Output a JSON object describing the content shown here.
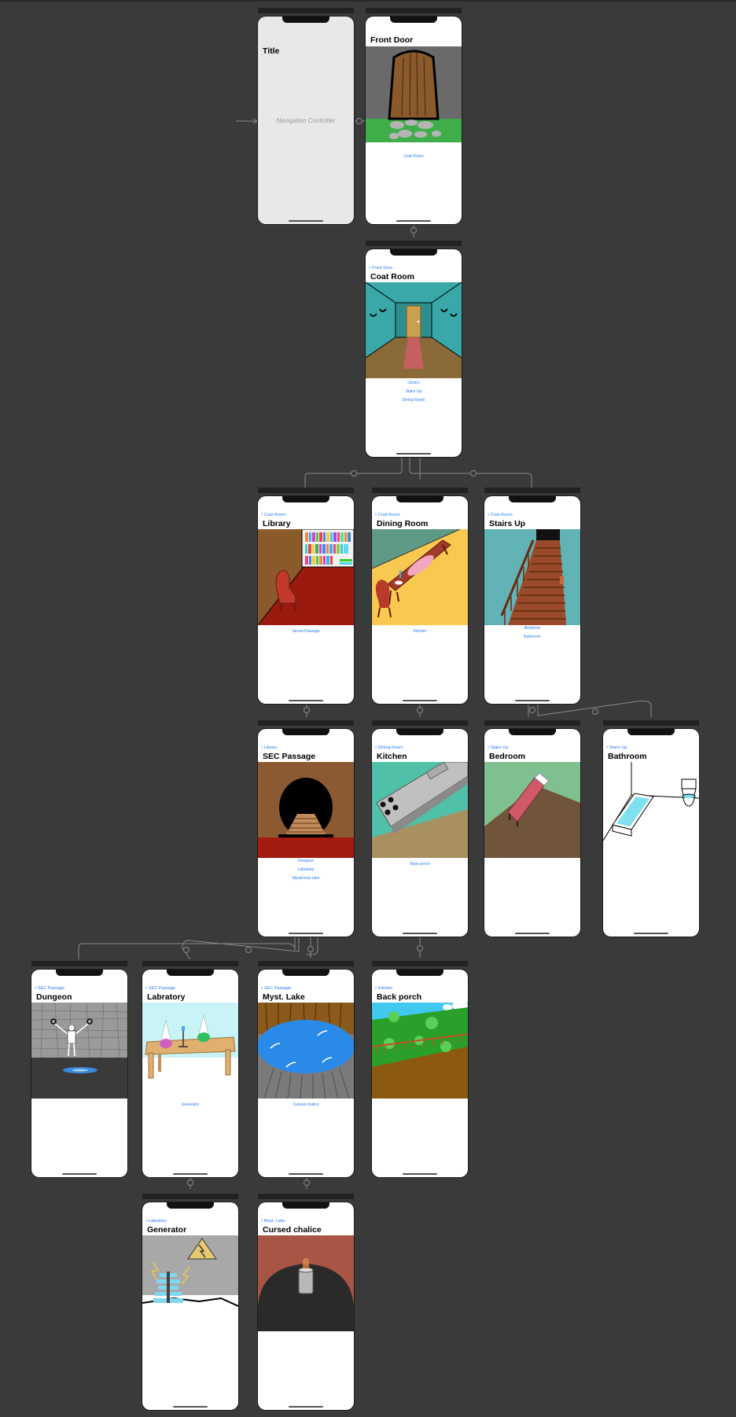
{
  "storyboard": {
    "nav_controller": {
      "title": "Title",
      "label": "Navigation Controller"
    },
    "scenes": {
      "front_door": {
        "title": "Front Door",
        "buttons": [
          "Coat Room"
        ]
      },
      "coat_room": {
        "back": "Front Door",
        "title": "Coat Room",
        "buttons": [
          "Library",
          "Stairs Up",
          "Dining Room"
        ]
      },
      "library": {
        "back": "Coat Room",
        "title": "Library",
        "buttons": [
          "Secret Passage"
        ]
      },
      "dining_room": {
        "back": "Coat Room",
        "title": "Dining Room",
        "buttons": [
          "Kitchen"
        ]
      },
      "stairs_up": {
        "back": "Coat Room",
        "title": "Stairs Up",
        "buttons": [
          "Bedroom",
          "Bathroom"
        ]
      },
      "sec_passage": {
        "back": "Library",
        "title": "SEC Passage",
        "buttons": [
          "Dungeon",
          "Labratory",
          "Mysterious lake"
        ]
      },
      "kitchen": {
        "back": "Dining Room",
        "title": "Kitchen",
        "buttons": [
          "Back porch"
        ]
      },
      "bedroom": {
        "back": "Stairs Up",
        "title": "Bedroom",
        "buttons": []
      },
      "bathroom": {
        "back": "Stairs Up",
        "title": "Bathroom",
        "buttons": []
      },
      "dungeon": {
        "back": "SEC Passage",
        "title": "Dungeon",
        "buttons": []
      },
      "labratory": {
        "back": "SEC Passage",
        "title": "Labratory",
        "buttons": [
          "Generator"
        ]
      },
      "myst_lake": {
        "back": "SEC Passage",
        "title": "Myst. Lake",
        "buttons": [
          "Cursed chalice"
        ]
      },
      "back_porch": {
        "back": "Kitchen",
        "title": "Back porch",
        "buttons": []
      },
      "generator": {
        "back": "Labratory",
        "title": "Generator",
        "buttons": []
      },
      "cursed_chalice": {
        "back": "Myst. Lake",
        "title": "Cursed chalice",
        "buttons": []
      }
    }
  },
  "colors": {
    "canvas": "#3a3a3a",
    "link": "#2b7bf0",
    "segue_line": "#8a8a8a"
  }
}
